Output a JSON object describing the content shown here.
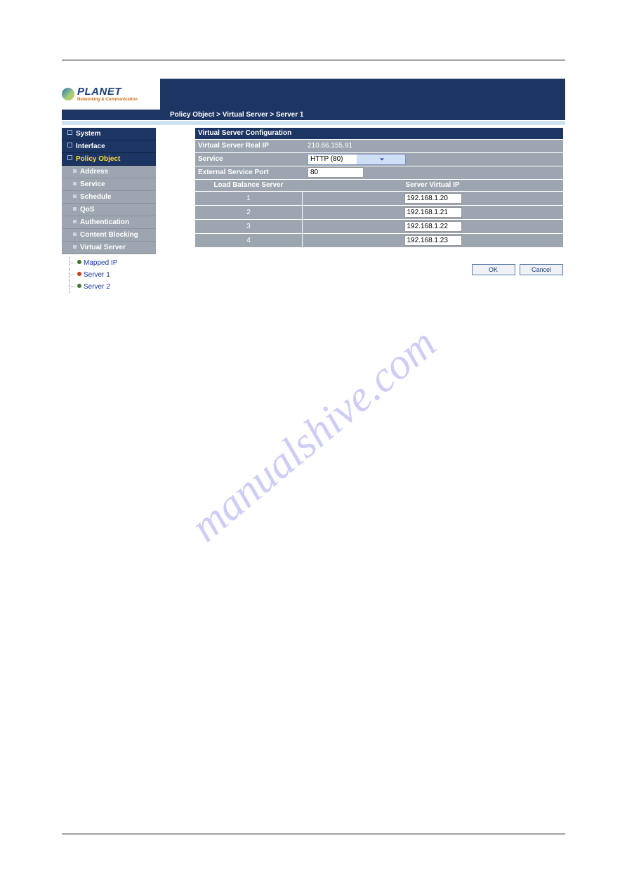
{
  "logo": {
    "title": "PLANET",
    "tagline": "Networking & Communication"
  },
  "breadcrumb": "Policy Object > Virtual Server > Server 1",
  "sidebar": {
    "top": [
      {
        "label": "System"
      },
      {
        "label": "Interface"
      },
      {
        "label": "Policy Object",
        "active": true
      }
    ],
    "sub": [
      {
        "label": "Address"
      },
      {
        "label": "Service"
      },
      {
        "label": "Schedule"
      },
      {
        "label": "QoS"
      },
      {
        "label": "Authentication"
      },
      {
        "label": "Content Blocking"
      },
      {
        "label": "Virtual Server",
        "expanded": true
      }
    ],
    "tree": [
      {
        "label": "Mapped IP"
      },
      {
        "label": "Server 1",
        "current": true
      },
      {
        "label": "Server 2"
      }
    ]
  },
  "panel": {
    "title": "Virtual Server Configuration",
    "real_ip_label": "Virtual Server Real IP",
    "real_ip_value": "210.66.155.91",
    "service_label": "Service",
    "service_value": "HTTP (80)",
    "ext_port_label": "External Service Port",
    "ext_port_value": "80",
    "col_load": "Load Balance Server",
    "col_vip": "Server Virtual IP",
    "servers": [
      {
        "n": "1",
        "ip": "192.168.1.20"
      },
      {
        "n": "2",
        "ip": "192.168.1.21"
      },
      {
        "n": "3",
        "ip": "192.168.1.22"
      },
      {
        "n": "4",
        "ip": "192.168.1.23"
      }
    ]
  },
  "buttons": {
    "ok": "OK",
    "cancel": "Cancel"
  },
  "watermark": "manualshive.com"
}
